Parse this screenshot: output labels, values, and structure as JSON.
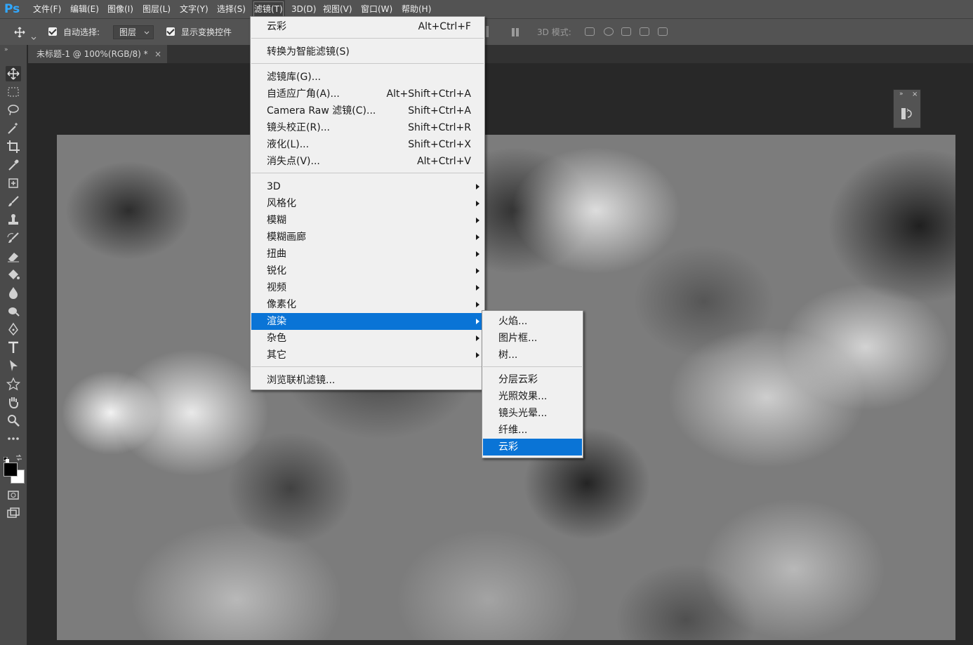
{
  "app": {
    "logo": "Ps"
  },
  "menubar": {
    "items": [
      "文件(F)",
      "编辑(E)",
      "图像(I)",
      "图层(L)",
      "文字(Y)",
      "选择(S)",
      "滤镜(T)",
      "3D(D)",
      "视图(V)",
      "窗口(W)",
      "帮助(H)"
    ],
    "active": "滤镜(T)"
  },
  "options_bar": {
    "auto_select_label": "自动选择:",
    "auto_select_checked": true,
    "layer_select_value": "图层",
    "show_transform_label": "显示变换控件",
    "show_transform_checked": true,
    "mode_3d_label": "3D 模式:"
  },
  "document_tab": {
    "title": "未标题-1 @ 100%(RGB/8) *",
    "close": "×"
  },
  "filter_menu": {
    "items": [
      {
        "label": "云彩",
        "shortcut": "Alt+Ctrl+F"
      },
      {
        "label": "转换为智能滤镜(S)",
        "shortcut": ""
      },
      {
        "label": "滤镜库(G)...",
        "shortcut": ""
      },
      {
        "label": "自适应广角(A)...",
        "shortcut": "Alt+Shift+Ctrl+A"
      },
      {
        "label": "Camera Raw 滤镜(C)...",
        "shortcut": "Shift+Ctrl+A"
      },
      {
        "label": "镜头校正(R)...",
        "shortcut": "Shift+Ctrl+R"
      },
      {
        "label": "液化(L)...",
        "shortcut": "Shift+Ctrl+X"
      },
      {
        "label": "消失点(V)...",
        "shortcut": "Alt+Ctrl+V"
      },
      {
        "label": "3D",
        "submenu": true
      },
      {
        "label": "风格化",
        "submenu": true
      },
      {
        "label": "模糊",
        "submenu": true
      },
      {
        "label": "模糊画廊",
        "submenu": true
      },
      {
        "label": "扭曲",
        "submenu": true
      },
      {
        "label": "锐化",
        "submenu": true
      },
      {
        "label": "视频",
        "submenu": true
      },
      {
        "label": "像素化",
        "submenu": true
      },
      {
        "label": "渲染",
        "submenu": true,
        "highlighted": true
      },
      {
        "label": "杂色",
        "submenu": true
      },
      {
        "label": "其它",
        "submenu": true
      },
      {
        "label": "浏览联机滤镜...",
        "shortcut": ""
      }
    ]
  },
  "render_submenu": {
    "items": [
      {
        "label": "火焰..."
      },
      {
        "label": "图片框..."
      },
      {
        "label": "树..."
      },
      {
        "label": "分层云彩"
      },
      {
        "label": "光照效果..."
      },
      {
        "label": "镜头光晕..."
      },
      {
        "label": "纤维..."
      },
      {
        "label": "云彩",
        "highlighted": true
      }
    ]
  },
  "tools": [
    "move-icon",
    "marquee-icon",
    "lasso-icon",
    "magic-wand-icon",
    "crop-icon",
    "eyedropper-icon",
    "healing-brush-icon",
    "brush-icon",
    "clone-stamp-icon",
    "history-brush-icon",
    "eraser-icon",
    "paint-bucket-icon",
    "blur-icon",
    "dodge-icon",
    "pen-icon",
    "type-icon",
    "path-selection-icon",
    "shape-icon",
    "hand-icon",
    "zoom-icon",
    "more-tools-icon"
  ],
  "colors": {
    "accent": "#0a74d6",
    "menubar_bg": "#535353",
    "app_bg": "#282828",
    "foreground": "#000000",
    "background": "#ffffff"
  }
}
